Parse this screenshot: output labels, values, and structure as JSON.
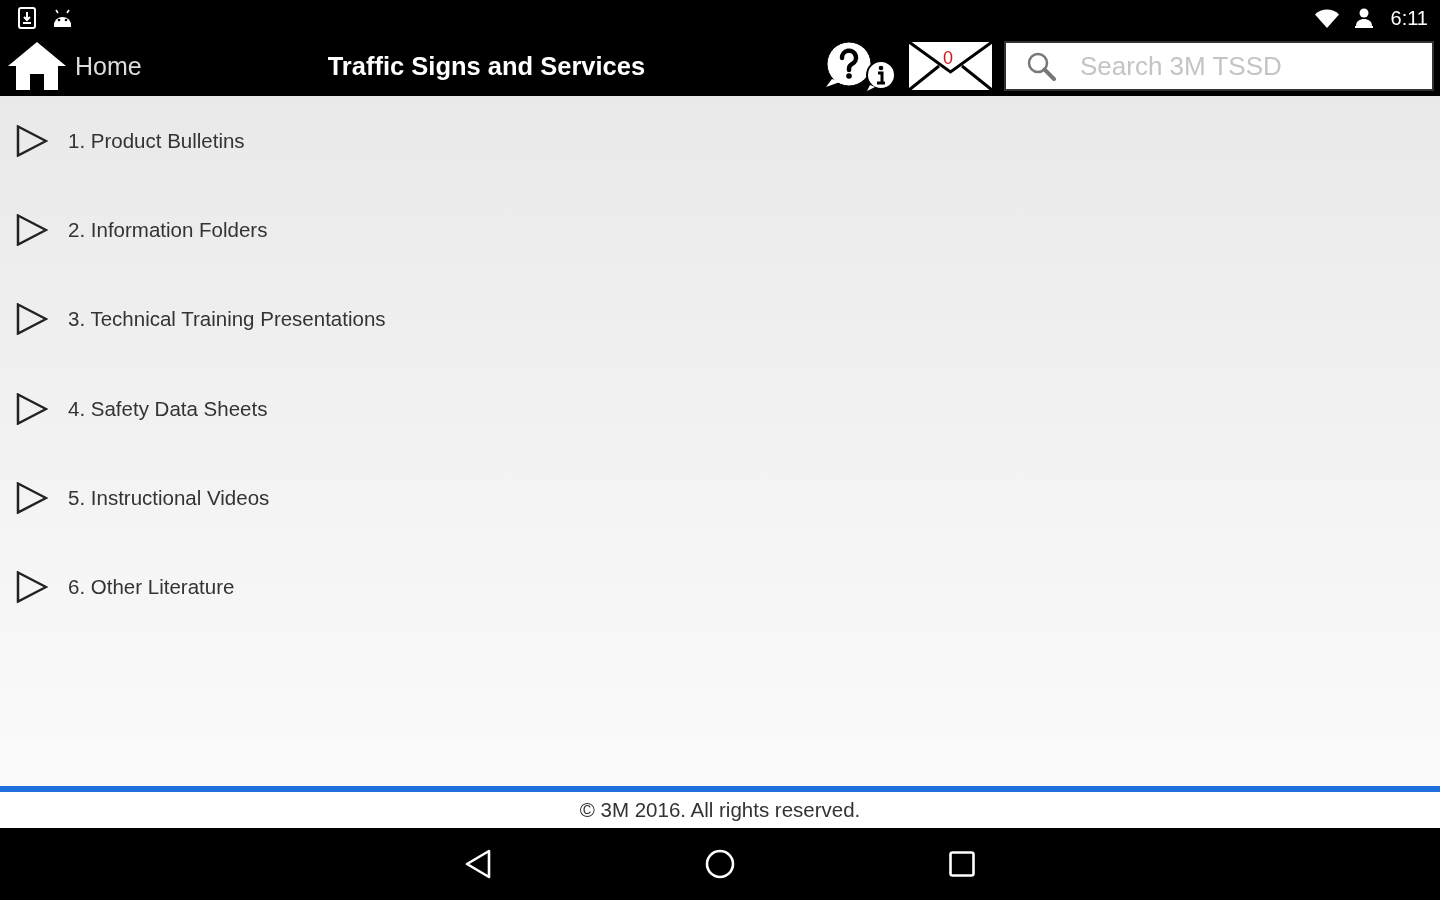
{
  "status_bar": {
    "time": "6:11"
  },
  "app_bar": {
    "home_label": "Home",
    "title": "Traffic Signs and Services",
    "mail_count": "0",
    "search": {
      "placeholder": "Search 3M TSSD"
    }
  },
  "list": {
    "items": [
      {
        "label": "1. Product Bulletins",
        "expanded": false
      },
      {
        "label": "2. Information Folders",
        "expanded": false
      },
      {
        "label": "3. Technical Training Presentations",
        "expanded": false
      },
      {
        "label": "4. Safety Data Sheets",
        "expanded": false
      },
      {
        "label": "5. Instructional Videos",
        "expanded": false
      },
      {
        "label": "6. Other Literature",
        "expanded": false
      }
    ]
  },
  "footer": {
    "text": "© 3M 2016. All rights reserved."
  }
}
